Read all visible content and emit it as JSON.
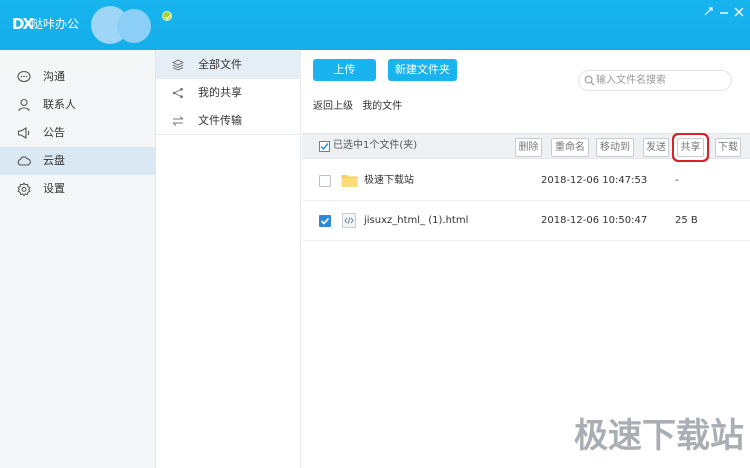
{
  "app": {
    "logo_text": "DX",
    "title": "哒咔办公"
  },
  "sidebar": {
    "items": [
      {
        "label": "沟通",
        "icon": "chat-icon"
      },
      {
        "label": "联系人",
        "icon": "person-icon"
      },
      {
        "label": "公告",
        "icon": "megaphone-icon"
      },
      {
        "label": "云盘",
        "icon": "cloud-icon",
        "active": true
      },
      {
        "label": "设置",
        "icon": "gear-icon"
      }
    ]
  },
  "subnav": {
    "items": [
      {
        "label": "全部文件",
        "icon": "layers-icon",
        "active": true
      },
      {
        "label": "我的共享",
        "icon": "share-icon"
      },
      {
        "label": "文件传输",
        "icon": "transfer-icon"
      }
    ]
  },
  "main": {
    "upload_label": "上传",
    "new_folder_label": "新建文件夹",
    "search": {
      "placeholder": "输入文件名搜索"
    },
    "breadcrumb": {
      "back": "返回上级",
      "current": "我的文件"
    },
    "toolbar": {
      "selection_label": "已选中1个文件(夹)",
      "buttons": [
        "删除",
        "重命名",
        "移动到",
        "发送",
        "共享",
        "下载"
      ]
    },
    "files": [
      {
        "name": "极速下载站",
        "date": "2018-12-06 10:47:53",
        "size": "-",
        "type": "folder",
        "checked": false
      },
      {
        "name": "jisuxz_html_ (1).html",
        "date": "2018-12-06 10:50:47",
        "size": "25 B",
        "type": "html",
        "checked": true
      }
    ]
  },
  "colors": {
    "accent": "#19b3ef",
    "highlight": "#d8232a"
  },
  "watermark": "极速下载站"
}
